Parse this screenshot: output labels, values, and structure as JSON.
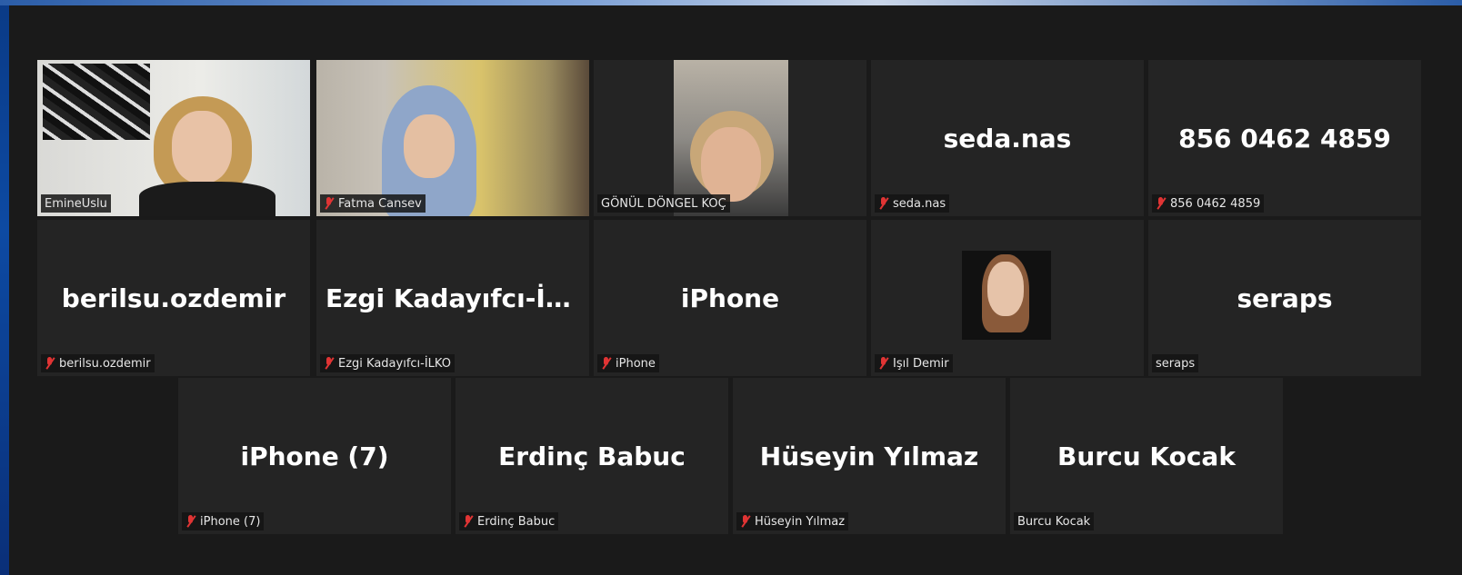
{
  "participants": [
    {
      "tile_name": "",
      "label": "EmineUslu",
      "muted": false,
      "active": true,
      "video": "v1"
    },
    {
      "tile_name": "",
      "label": "Fatma Cansev",
      "muted": true,
      "active": false,
      "video": "v2"
    },
    {
      "tile_name": "",
      "label": "GÖNÜL DÖNGEL KOÇ",
      "muted": false,
      "active": false,
      "video": "v3"
    },
    {
      "tile_name": "seda.nas",
      "label": "seda.nas",
      "muted": true
    },
    {
      "tile_name": "856 0462 4859",
      "label": "856 0462 4859",
      "muted": true
    },
    {
      "tile_name": "berilsu.ozdemir",
      "label": "berilsu.ozdemir",
      "muted": true
    },
    {
      "tile_name": "Ezgi  Kadayıfcı-İL...",
      "label": "Ezgi Kadayıfcı-İLKO",
      "muted": true
    },
    {
      "tile_name": "iPhone",
      "label": "iPhone",
      "muted": true
    },
    {
      "tile_name": "",
      "label": "Işıl Demir",
      "muted": true,
      "video": "v4"
    },
    {
      "tile_name": "seraps",
      "label": "seraps",
      "muted": false
    },
    {
      "tile_name": "iPhone (7)",
      "label": "iPhone (7)",
      "muted": true
    },
    {
      "tile_name": "Erdinç Babuc",
      "label": "Erdinç Babuc",
      "muted": true
    },
    {
      "tile_name": "Hüseyin Yılmaz",
      "label": "Hüseyin Yılmaz",
      "muted": true
    },
    {
      "tile_name": "Burcu Kocak",
      "label": "Burcu Kocak",
      "muted": false
    }
  ],
  "colors": {
    "active_border": "#b9dc4b",
    "muted_icon": "#e03434",
    "tile_bg": "#242424"
  }
}
